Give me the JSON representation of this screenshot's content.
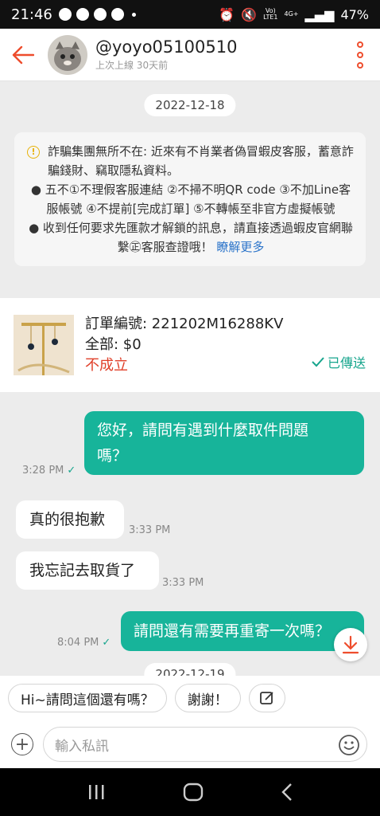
{
  "status_bar": {
    "time": "21:46",
    "signal_top": "Vo)",
    "signal_bottom": "LTE1",
    "net_top": "4G+",
    "battery": "47%"
  },
  "header": {
    "username": "@yoyo05100510",
    "last_seen": "上次上線 30天前"
  },
  "date_separator": "2022-12-18",
  "notice": {
    "line1": "詐騙集團無所不在: 近來有不肖業者偽冒蝦皮客服，蓄意詐騙錢財、竊取隱私資料。",
    "line2": "● 五不①不理假客服連結 ②不掃不明QR code ③不加Line客服帳號 ④不提前[完成訂單] ⑤不轉帳至非官方虛擬帳號",
    "line3": "● 收到任何要求先匯款才解鎖的訊息，請直接透過蝦皮官網聯繫㊣客服查證哦！",
    "link": "瞭解更多"
  },
  "order": {
    "number": "訂單編號: 221202M16288KV",
    "total": "全部: $0",
    "status": "不成立",
    "sent": "已傳送"
  },
  "messages": [
    {
      "dir": "out",
      "text1": "您好，請問有遇到什麼取件問題",
      "text2": "嗎？",
      "time": "3:28 PM"
    },
    {
      "dir": "in",
      "text": "真的很抱歉",
      "time": "3:33 PM"
    },
    {
      "dir": "in",
      "text": "我忘記去取貨了",
      "time": "3:33 PM"
    },
    {
      "dir": "out",
      "text": "請問還有需要再重寄一次嗎？",
      "time": "8:04 PM"
    }
  ],
  "next_date_partial": "2022-12-19",
  "quick_replies": [
    "Hi~請問這個還有嗎？",
    "謝謝！"
  ],
  "input": {
    "placeholder": "輸入私訊"
  },
  "colors": {
    "brand": "#ee4d2d",
    "outgoing_bubble": "#17b49a",
    "link": "#2a73c9",
    "failed": "#e0402a"
  }
}
